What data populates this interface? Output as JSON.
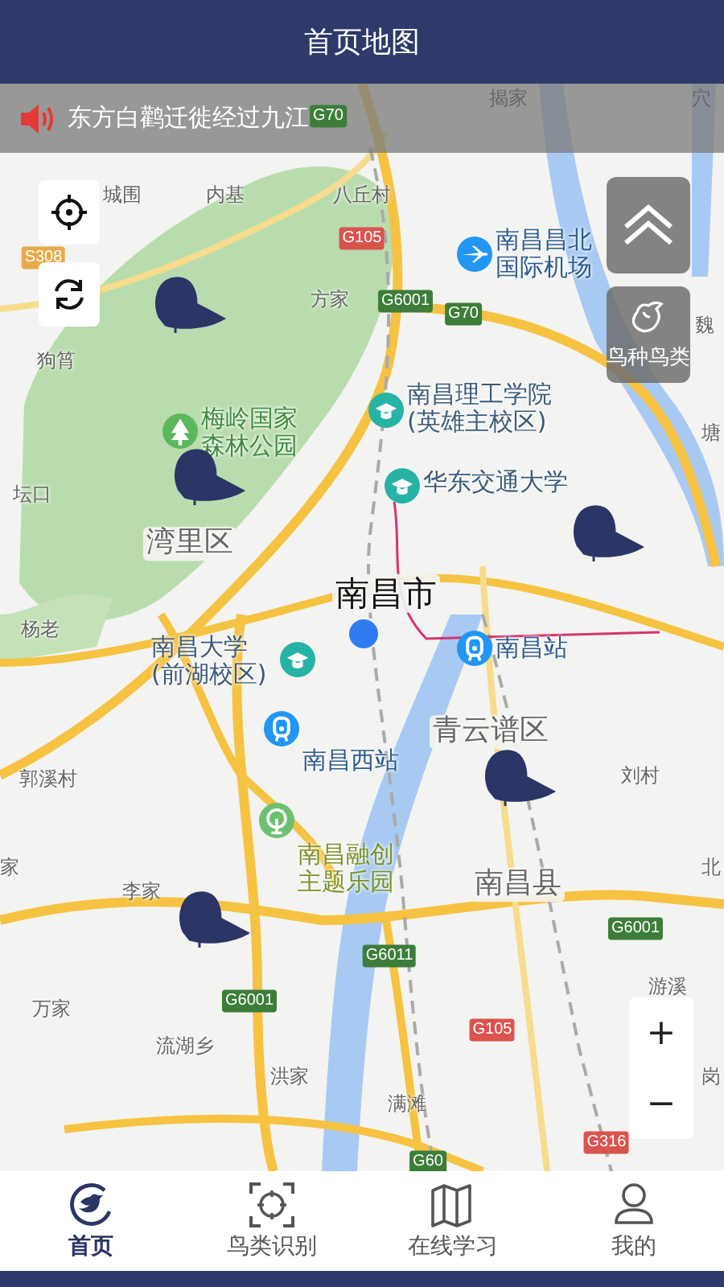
{
  "header": {
    "title": "首页地图"
  },
  "notice": {
    "text": "东方白鹳迁徙经过九江"
  },
  "map": {
    "labels": [
      {
        "text": "揭家",
        "kind": "place"
      },
      {
        "text": "穴",
        "kind": "place"
      },
      {
        "text": "G70",
        "kind": "highway"
      },
      {
        "text": "城围",
        "kind": "place"
      },
      {
        "text": "内基",
        "kind": "place"
      },
      {
        "text": "八丘村",
        "kind": "place"
      },
      {
        "text": "G105",
        "kind": "national_road"
      },
      {
        "text": "S308",
        "kind": "provincial_road"
      },
      {
        "text": "南昌昌北国际机场",
        "kind": "airport"
      },
      {
        "text": "方家",
        "kind": "place"
      },
      {
        "text": "G6001",
        "kind": "highway"
      },
      {
        "text": "G70",
        "kind": "highway"
      },
      {
        "text": "魏",
        "kind": "place"
      },
      {
        "text": "狗筲",
        "kind": "place"
      },
      {
        "text": "南昌理工学院(英雄主校区)",
        "kind": "school"
      },
      {
        "text": "梅岭国家森林公园",
        "kind": "forest_park"
      },
      {
        "text": "塘",
        "kind": "place"
      },
      {
        "text": "坛口",
        "kind": "place"
      },
      {
        "text": "华东交通大学",
        "kind": "school"
      },
      {
        "text": "湾里区",
        "kind": "district"
      },
      {
        "text": "杨老",
        "kind": "place"
      },
      {
        "text": "南昌市",
        "kind": "city"
      },
      {
        "text": "南昌大学(前湖校区)",
        "kind": "school"
      },
      {
        "text": "南昌站",
        "kind": "station"
      },
      {
        "text": "南昌西站",
        "kind": "station"
      },
      {
        "text": "青云谱区",
        "kind": "district"
      },
      {
        "text": "郭溪村",
        "kind": "place"
      },
      {
        "text": "刘村",
        "kind": "place"
      },
      {
        "text": "家",
        "kind": "place"
      },
      {
        "text": "南昌融创主题乐园",
        "kind": "theme_park"
      },
      {
        "text": "北",
        "kind": "place"
      },
      {
        "text": "李家",
        "kind": "place"
      },
      {
        "text": "南昌县",
        "kind": "district"
      },
      {
        "text": "G6001",
        "kind": "highway"
      },
      {
        "text": "G6011",
        "kind": "highway"
      },
      {
        "text": "G6001",
        "kind": "highway"
      },
      {
        "text": "游溪",
        "kind": "place"
      },
      {
        "text": "万家",
        "kind": "place"
      },
      {
        "text": "流湖乡",
        "kind": "place"
      },
      {
        "text": "G105",
        "kind": "national_road"
      },
      {
        "text": "洪家",
        "kind": "place"
      },
      {
        "text": "岗",
        "kind": "place"
      },
      {
        "text": "满滩",
        "kind": "place"
      },
      {
        "text": "G316",
        "kind": "national_road"
      },
      {
        "text": "G60",
        "kind": "highway"
      }
    ],
    "species_button": {
      "label": "鸟种鸟类"
    },
    "zoom": {
      "in": "+",
      "out": "−"
    }
  },
  "nav": [
    {
      "label": "首页",
      "selected": true
    },
    {
      "label": "鸟类识别",
      "selected": false
    },
    {
      "label": "在线学习",
      "selected": false
    },
    {
      "label": "我的",
      "selected": false
    }
  ]
}
